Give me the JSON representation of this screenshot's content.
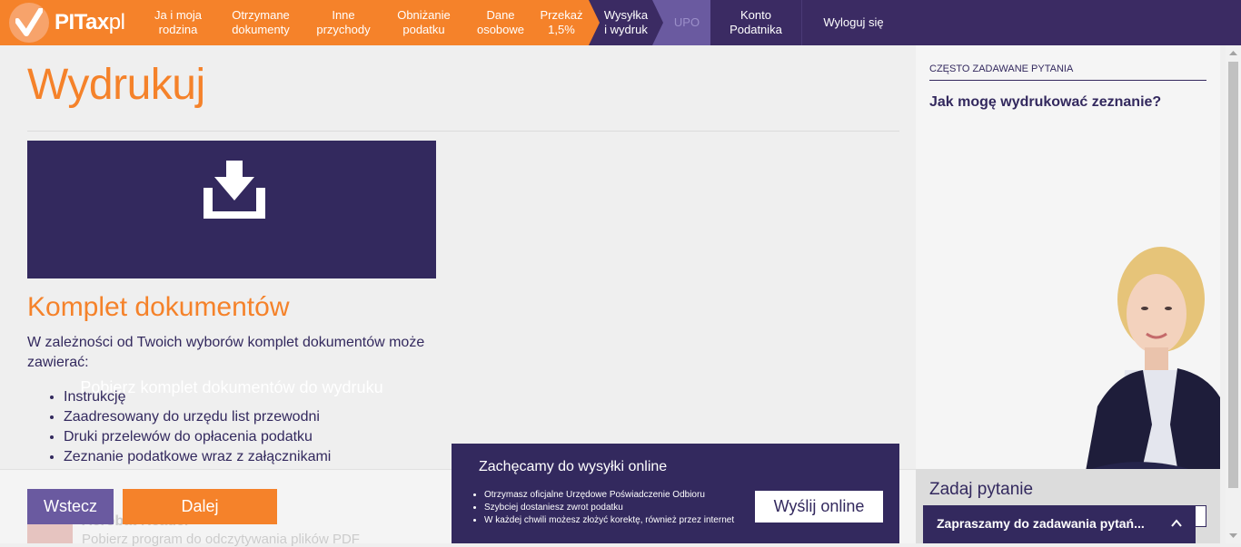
{
  "brand": {
    "name_main": "PITax",
    "name_suffix": "pl"
  },
  "nav": {
    "items": [
      {
        "label": "Ja i moja\nrodzina"
      },
      {
        "label": "Otrzymane\ndokumenty"
      },
      {
        "label": "Inne\nprzychody"
      },
      {
        "label": "Obniżanie\npodatku"
      },
      {
        "label": "Dane\nosobowe"
      },
      {
        "label": "Przekaż\n1,5%"
      },
      {
        "label": "Wysyłka\ni wydruk"
      },
      {
        "label": "UPO"
      },
      {
        "label": "Konto\nPodatnika"
      },
      {
        "label": "Wyloguj się"
      }
    ]
  },
  "main": {
    "title": "Wydrukuj",
    "download_label": "Pobierz komplet dokumentów do wydruku",
    "set_heading": "Komplet dokumentów",
    "set_description": "W zależności od Twoich wyborów komplet dokumentów może zawierać:",
    "set_items": [
      "Instrukcję",
      "Zaadresowany do urzędu list przewodni",
      "Druki przelewów do opłacenia podatku",
      "Zeznanie podatkowe wraz z załącznikami"
    ],
    "acrobat_title": "Acrobat Reader",
    "acrobat_sub": "Pobierz program do odczytywania plików PDF"
  },
  "footer": {
    "back_label": "Wstecz",
    "next_label": "Dalej"
  },
  "promo": {
    "title": "Zachęcamy do wysyłki online",
    "bullets": [
      "Otrzymasz oficjalne Urzędowe Poświadczenie Odbioru",
      "Szybciej dostaniesz zwrot podatku",
      "W każdej chwili możesz złożyć korektę, również przez internet"
    ],
    "send_label": "Wyślij online"
  },
  "sidebar": {
    "faq_heading": "CZĘSTO ZADAWANE PYTANIA",
    "faq_question": "Jak mogę wydrukować zeznanie?",
    "ask_title": "Zadaj pytanie",
    "chat_label": "Zapraszamy do zadawania pytań..."
  },
  "colors": {
    "orange": "#f5822a",
    "purple": "#33295e",
    "nav_purple": "#3b2b63",
    "disabled": "#6a5aa0"
  }
}
